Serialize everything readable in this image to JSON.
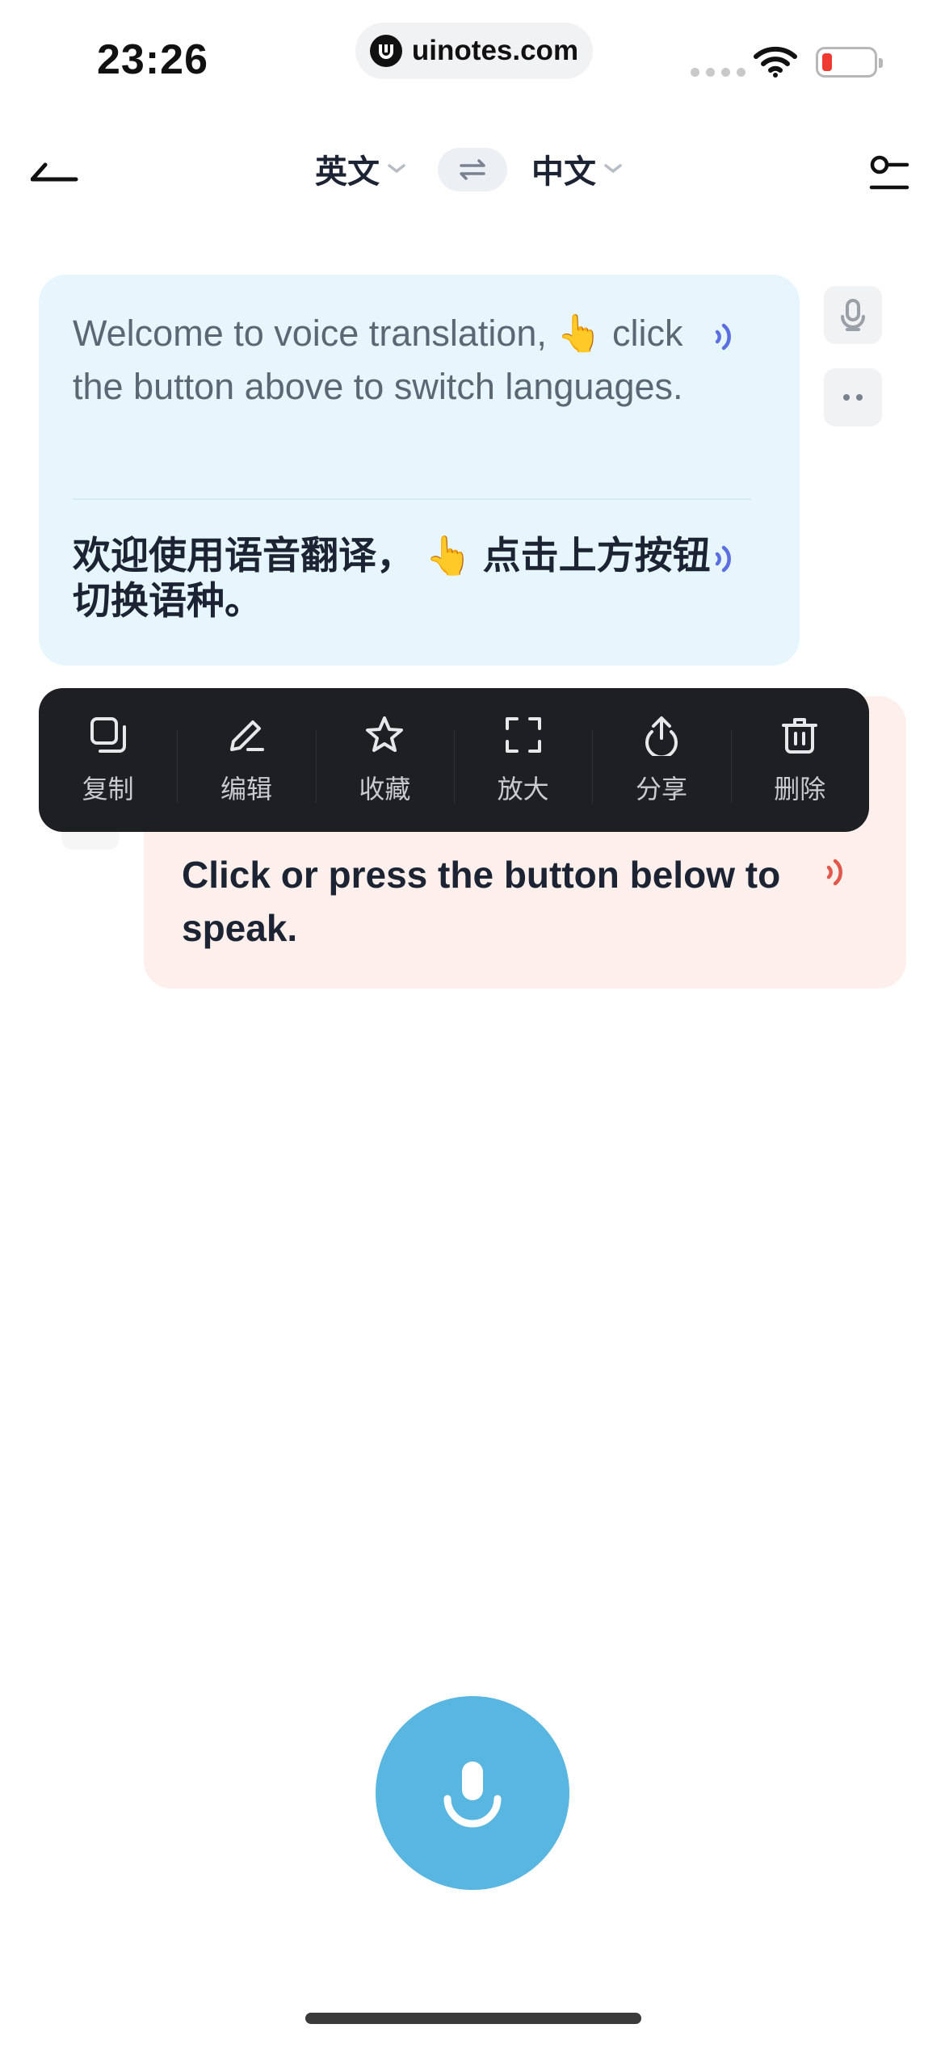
{
  "status_bar": {
    "time": "23:26",
    "url": "uinotes.com"
  },
  "nav": {
    "source_lang": "英文",
    "target_lang": "中文"
  },
  "cards": {
    "source_text": "Welcome to  voice translation, 👆 click the button above to switch languages.",
    "translated_text": "欢迎使用语音翻译， 👆 点击上方按钮切换语种。",
    "prompt_text": "Click or press the button below to speak."
  },
  "context_menu": {
    "items": [
      {
        "label": "复制",
        "icon": "copy-icon"
      },
      {
        "label": "编辑",
        "icon": "edit-icon"
      },
      {
        "label": "收藏",
        "icon": "star-icon"
      },
      {
        "label": "放大",
        "icon": "expand-icon"
      },
      {
        "label": "分享",
        "icon": "share-icon"
      },
      {
        "label": "删除",
        "icon": "trash-icon"
      }
    ]
  },
  "colors": {
    "accent": "#58b6e0",
    "source_card": "#e7f6fd",
    "prompt_card": "#fdf0ec",
    "play_blue": "#5b6fe0",
    "play_red": "#e2574c",
    "menu_bg": "#1e1f22"
  }
}
